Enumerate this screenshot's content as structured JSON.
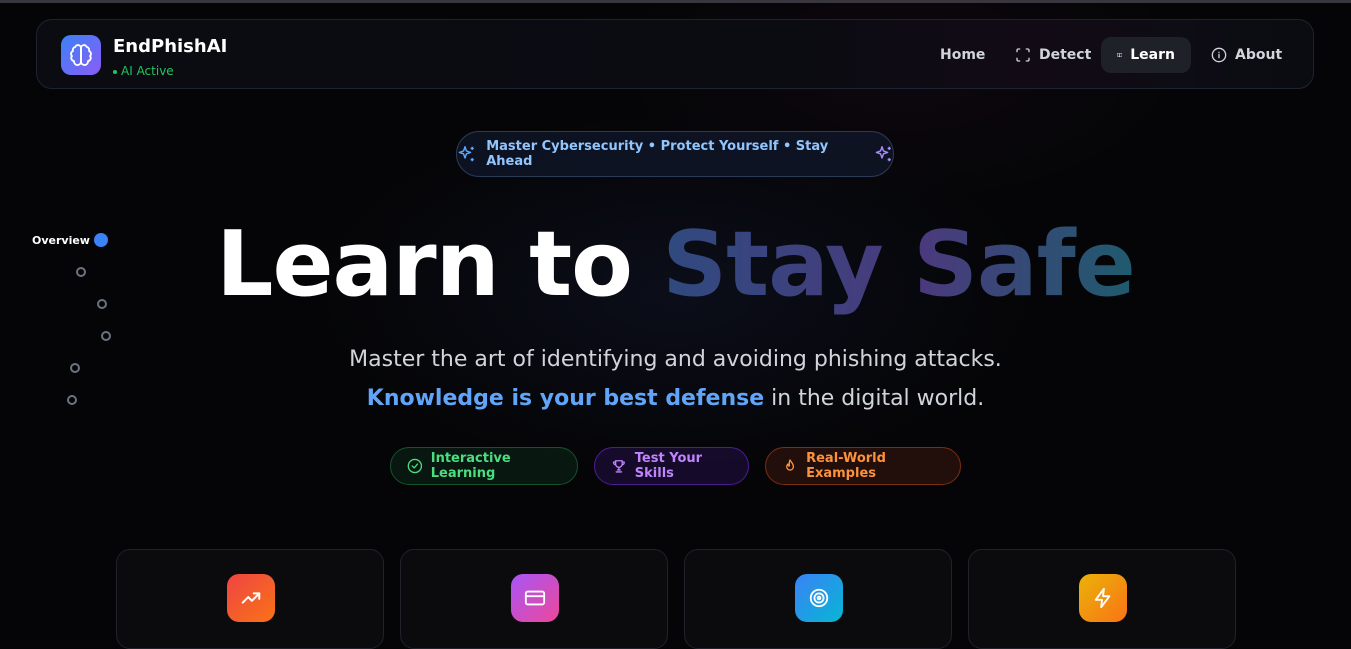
{
  "brand": {
    "name": "EndPhishAI",
    "status": "AI Active"
  },
  "nav": {
    "home": "Home",
    "detect": "Detect",
    "learn": "Learn",
    "about": "About"
  },
  "pill": {
    "text": "Master Cybersecurity • Protect Yourself • Stay Ahead"
  },
  "side_nav": {
    "active_label": "Overview"
  },
  "hero": {
    "title_plain": "Learn to ",
    "title_gradient": "Stay Safe",
    "subtitle_part1": "Master the art of identifying and avoiding phishing attacks. ",
    "subtitle_highlight": "Knowledge is your best defense",
    "subtitle_part2": " in the digital world."
  },
  "tags": {
    "interactive": "Interactive Learning",
    "test": "Test Your Skills",
    "examples": "Real-World Examples"
  },
  "cards": [
    {
      "icon": "trending-up-icon",
      "color": "#f97316"
    },
    {
      "icon": "credit-card-icon",
      "color": "#c026d3"
    },
    {
      "icon": "target-icon",
      "color": "#0ea5e9"
    },
    {
      "icon": "zap-icon",
      "color": "#f59e0b"
    }
  ],
  "colors": {
    "accent_blue": "#3b82f6",
    "status_green": "#22c55e",
    "highlight": "#60a5fa"
  }
}
